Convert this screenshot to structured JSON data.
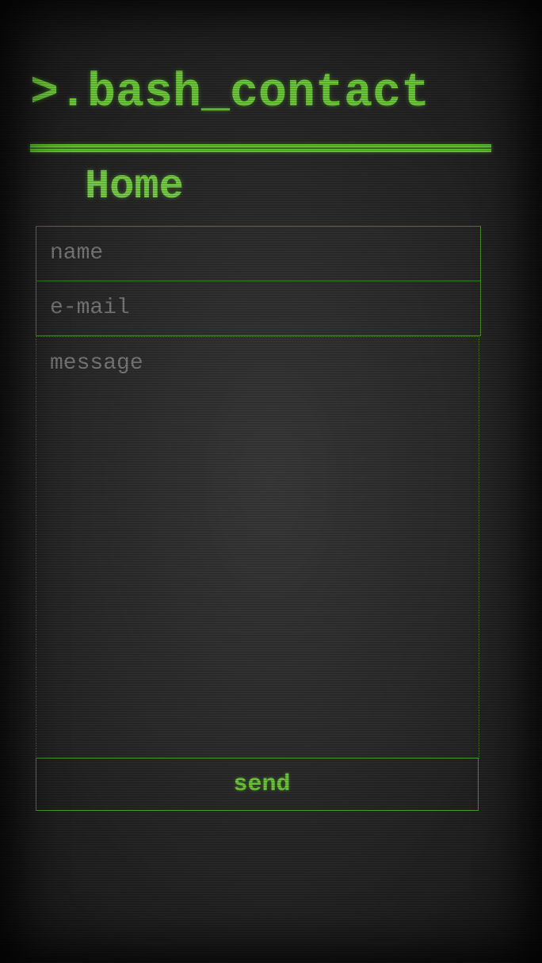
{
  "header": {
    "title": ">.bash_contact"
  },
  "nav": {
    "home_label": "Home"
  },
  "form": {
    "name_placeholder": "name",
    "email_placeholder": "e-mail",
    "message_placeholder": "message",
    "send_label": "send"
  },
  "colors": {
    "accent": "#6fcf3c",
    "background": "#2c2c2c",
    "placeholder": "#7d7d7d",
    "border": "#4f9a2a"
  }
}
